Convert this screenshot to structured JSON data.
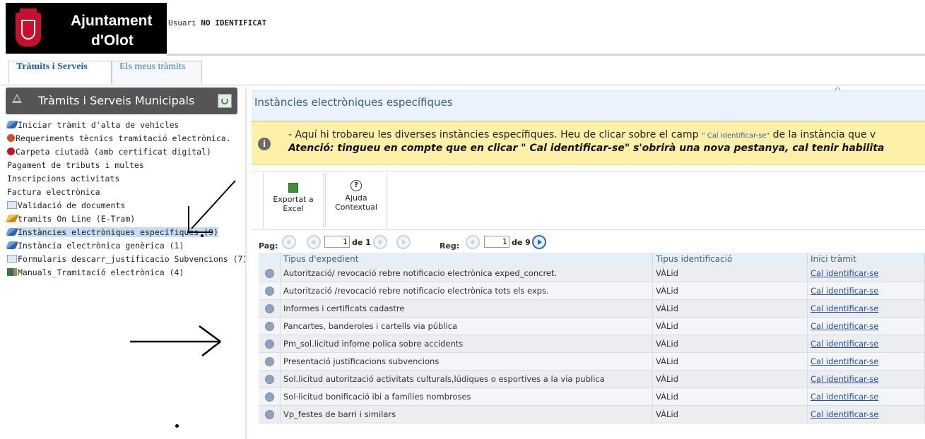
{
  "header": {
    "logo_line1": "Ajuntament",
    "logo_line2": "d'Olot",
    "user_prefix": "Usuari",
    "user_status": "NO IDENTIFICAT"
  },
  "tabs": [
    {
      "label": "Tràmits i Serveis",
      "active": true
    },
    {
      "label": "Els meus tràmits",
      "active": false
    }
  ],
  "left_panel": {
    "title": "Tràmits i Serveis Municipals",
    "items": [
      {
        "label": "Iniciar tràmit d'alta de vehicles",
        "icon": "pencil-icon"
      },
      {
        "label": "Requeriments tècnics tramitació electrònica.",
        "icon": "alert-icon"
      },
      {
        "label": "Carpeta ciutadà (amb certificat digital)",
        "icon": "seal-icon"
      },
      {
        "label": "Pagament de tributs i multes",
        "icon": ""
      },
      {
        "label": "Inscripcions activitats",
        "icon": ""
      },
      {
        "label": "Factura electrònica",
        "icon": ""
      },
      {
        "label": "Validació de documents",
        "icon": "document-icon"
      },
      {
        "label": "tramits On Line (E-Tram)",
        "icon": "pencil-yellow-icon"
      },
      {
        "label": "Instàncies electròniques específiques (9)",
        "icon": "pencil-icon",
        "selected": true
      },
      {
        "label": "Instància electrònica genèrica (1)",
        "icon": "pencil-icon"
      },
      {
        "label": "Formularis descarr_justificacio Subvencions (7)",
        "icon": "document-icon"
      },
      {
        "label": "Manuals_Tramitació electrònica (4)",
        "icon": "books-icon"
      }
    ]
  },
  "main": {
    "title": "Instàncies electròniques específiques",
    "info": {
      "line1_pre": "- Aquí hi trobareu les diverses instàncies específiques. Heu de clicar sobre el camp",
      "line1_link": "\" Cal identificar-se\"",
      "line1_post": "de la instància que v",
      "line2": "Atenció: tingueu en compte que en clicar \" Cal identificar-se\" s'obrirà una nova pestanya, cal tenir habilita"
    },
    "toolbar": {
      "export_line1": "Exportat a",
      "export_line2": "Excel",
      "help_line1": "Ajuda",
      "help_line2": "Contextual"
    },
    "pager": {
      "pag_label": "Pag:",
      "page_value": "1",
      "page_of": "de 1",
      "reg_label": "Reg:",
      "reg_value": "1",
      "reg_of": "de 9"
    },
    "table": {
      "columns": [
        "Tipus d'expedient",
        "Tipus identificació",
        "Inici tràmit"
      ],
      "rows": [
        {
          "tipus": "Autorització/ revocació rebre notificacio electrònica exped_concret.",
          "ident": "VÀLid",
          "inici": "Cal identificar-se"
        },
        {
          "tipus": "Autorització /revocació rebre notificacio electrònica tots els exps.",
          "ident": "VÀLid",
          "inici": "Cal identificar-se"
        },
        {
          "tipus": "Informes i certificats cadastre",
          "ident": "VÀLid",
          "inici": "Cal identificar-se"
        },
        {
          "tipus": "Pancartes, banderoles i cartells via pública",
          "ident": "VÀLid",
          "inici": "Cal identificar-se"
        },
        {
          "tipus": "Pm_sol.licitud infome polica sobre accidents",
          "ident": "VÀLid",
          "inici": "Cal identificar-se"
        },
        {
          "tipus": "Presentació justificacions subvencions",
          "ident": "VÀLid",
          "inici": "Cal identificar-se"
        },
        {
          "tipus": "Sol.licitud autorització activitats culturals,lúdiques o esportives a la via publica",
          "ident": "VÀLid",
          "inici": "Cal identificar-se"
        },
        {
          "tipus": "Sol·licitud bonificació ibi a famílies nombroses",
          "ident": "VÀLid",
          "inici": "Cal identificar-se"
        },
        {
          "tipus": "Vp_festes de barri i similars",
          "ident": "VÀLid",
          "inici": "Cal identificar-se"
        }
      ]
    }
  }
}
